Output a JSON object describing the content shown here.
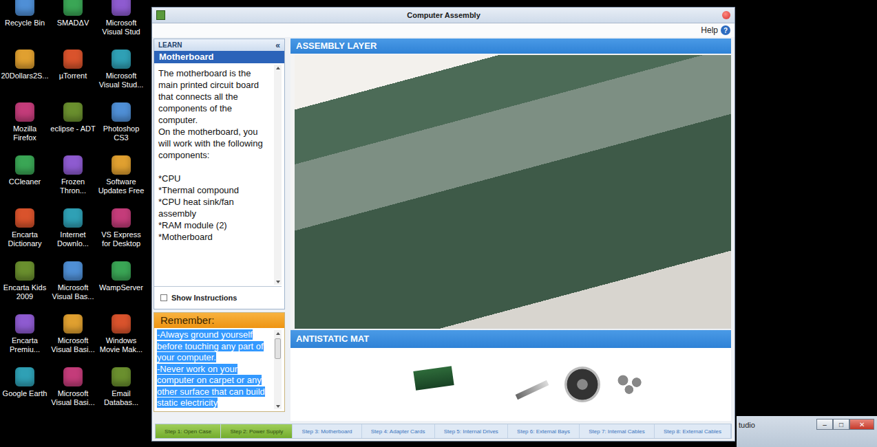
{
  "desktop": {
    "icons": [
      {
        "label": "Recycle Bin"
      },
      {
        "label": "SMADΔV"
      },
      {
        "label": "Microsoft Visual Stud"
      },
      {
        "label": "20Dollars2S..."
      },
      {
        "label": "µTorrent"
      },
      {
        "label": "Microsoft Visual Stud..."
      },
      {
        "label": "Mozilla Firefox"
      },
      {
        "label": "eclipse - ADT"
      },
      {
        "label": "Photoshop CS3"
      },
      {
        "label": "CCleaner"
      },
      {
        "label": "Frozen Thron..."
      },
      {
        "label": "Software Updates Free"
      },
      {
        "label": "Encarta Dictionary"
      },
      {
        "label": "Internet Downlo..."
      },
      {
        "label": "VS Express for Desktop"
      },
      {
        "label": "Encarta Kids 2009"
      },
      {
        "label": "Microsoft Visual Bas..."
      },
      {
        "label": "WampServer"
      },
      {
        "label": "Encarta Premiu..."
      },
      {
        "label": "Microsoft Visual Basi..."
      },
      {
        "label": "Windows Movie Mak..."
      },
      {
        "label": "Google Earth"
      },
      {
        "label": "Microsoft Visual Basi..."
      },
      {
        "label": "Email Databas..."
      }
    ]
  },
  "window": {
    "title": "Computer Assembly",
    "help": "Help",
    "help_icon": "?"
  },
  "learn": {
    "header": "LEARN",
    "collapse": "«",
    "topic": "Motherboard",
    "intro": [
      "The motherboard is the main printed circuit board that connects all the components of the computer.",
      "On the motherboard, you will work with the following components:"
    ],
    "components": [
      "*CPU",
      "*Thermal compound",
      "*CPU heat sink/fan assembly",
      "*RAM module (2)",
      "*Motherboard"
    ],
    "show_instructions": {
      "label": "Show Instructions",
      "checked": false
    }
  },
  "remember": {
    "header": "Remember:",
    "selected": true,
    "lines": [
      "-Always ground yourself before touching any part of your computer.",
      "-Never work on your computer on carpet or any other surface that can build static electricity"
    ]
  },
  "assembly": {
    "header": "ASSEMBLY LAYER"
  },
  "mat": {
    "header": "ANTISTATIC MAT"
  },
  "steps": [
    {
      "label": "Step 1: Open Case",
      "done": true
    },
    {
      "label": "Step 2: Power Supply",
      "done": true
    },
    {
      "label": "Step 3: Motherboard",
      "done": false
    },
    {
      "label": "Step 4: Adapter Cards",
      "done": false
    },
    {
      "label": "Step 5: Internal Drives",
      "done": false
    },
    {
      "label": "Step 6: External Bays",
      "done": false
    },
    {
      "label": "Step 7: Internal Cables",
      "done": false
    },
    {
      "label": "Step 8: External Cables",
      "done": false
    }
  ],
  "background_window": {
    "title": "tudio",
    "buttons": [
      "–",
      "□",
      "✕"
    ]
  }
}
